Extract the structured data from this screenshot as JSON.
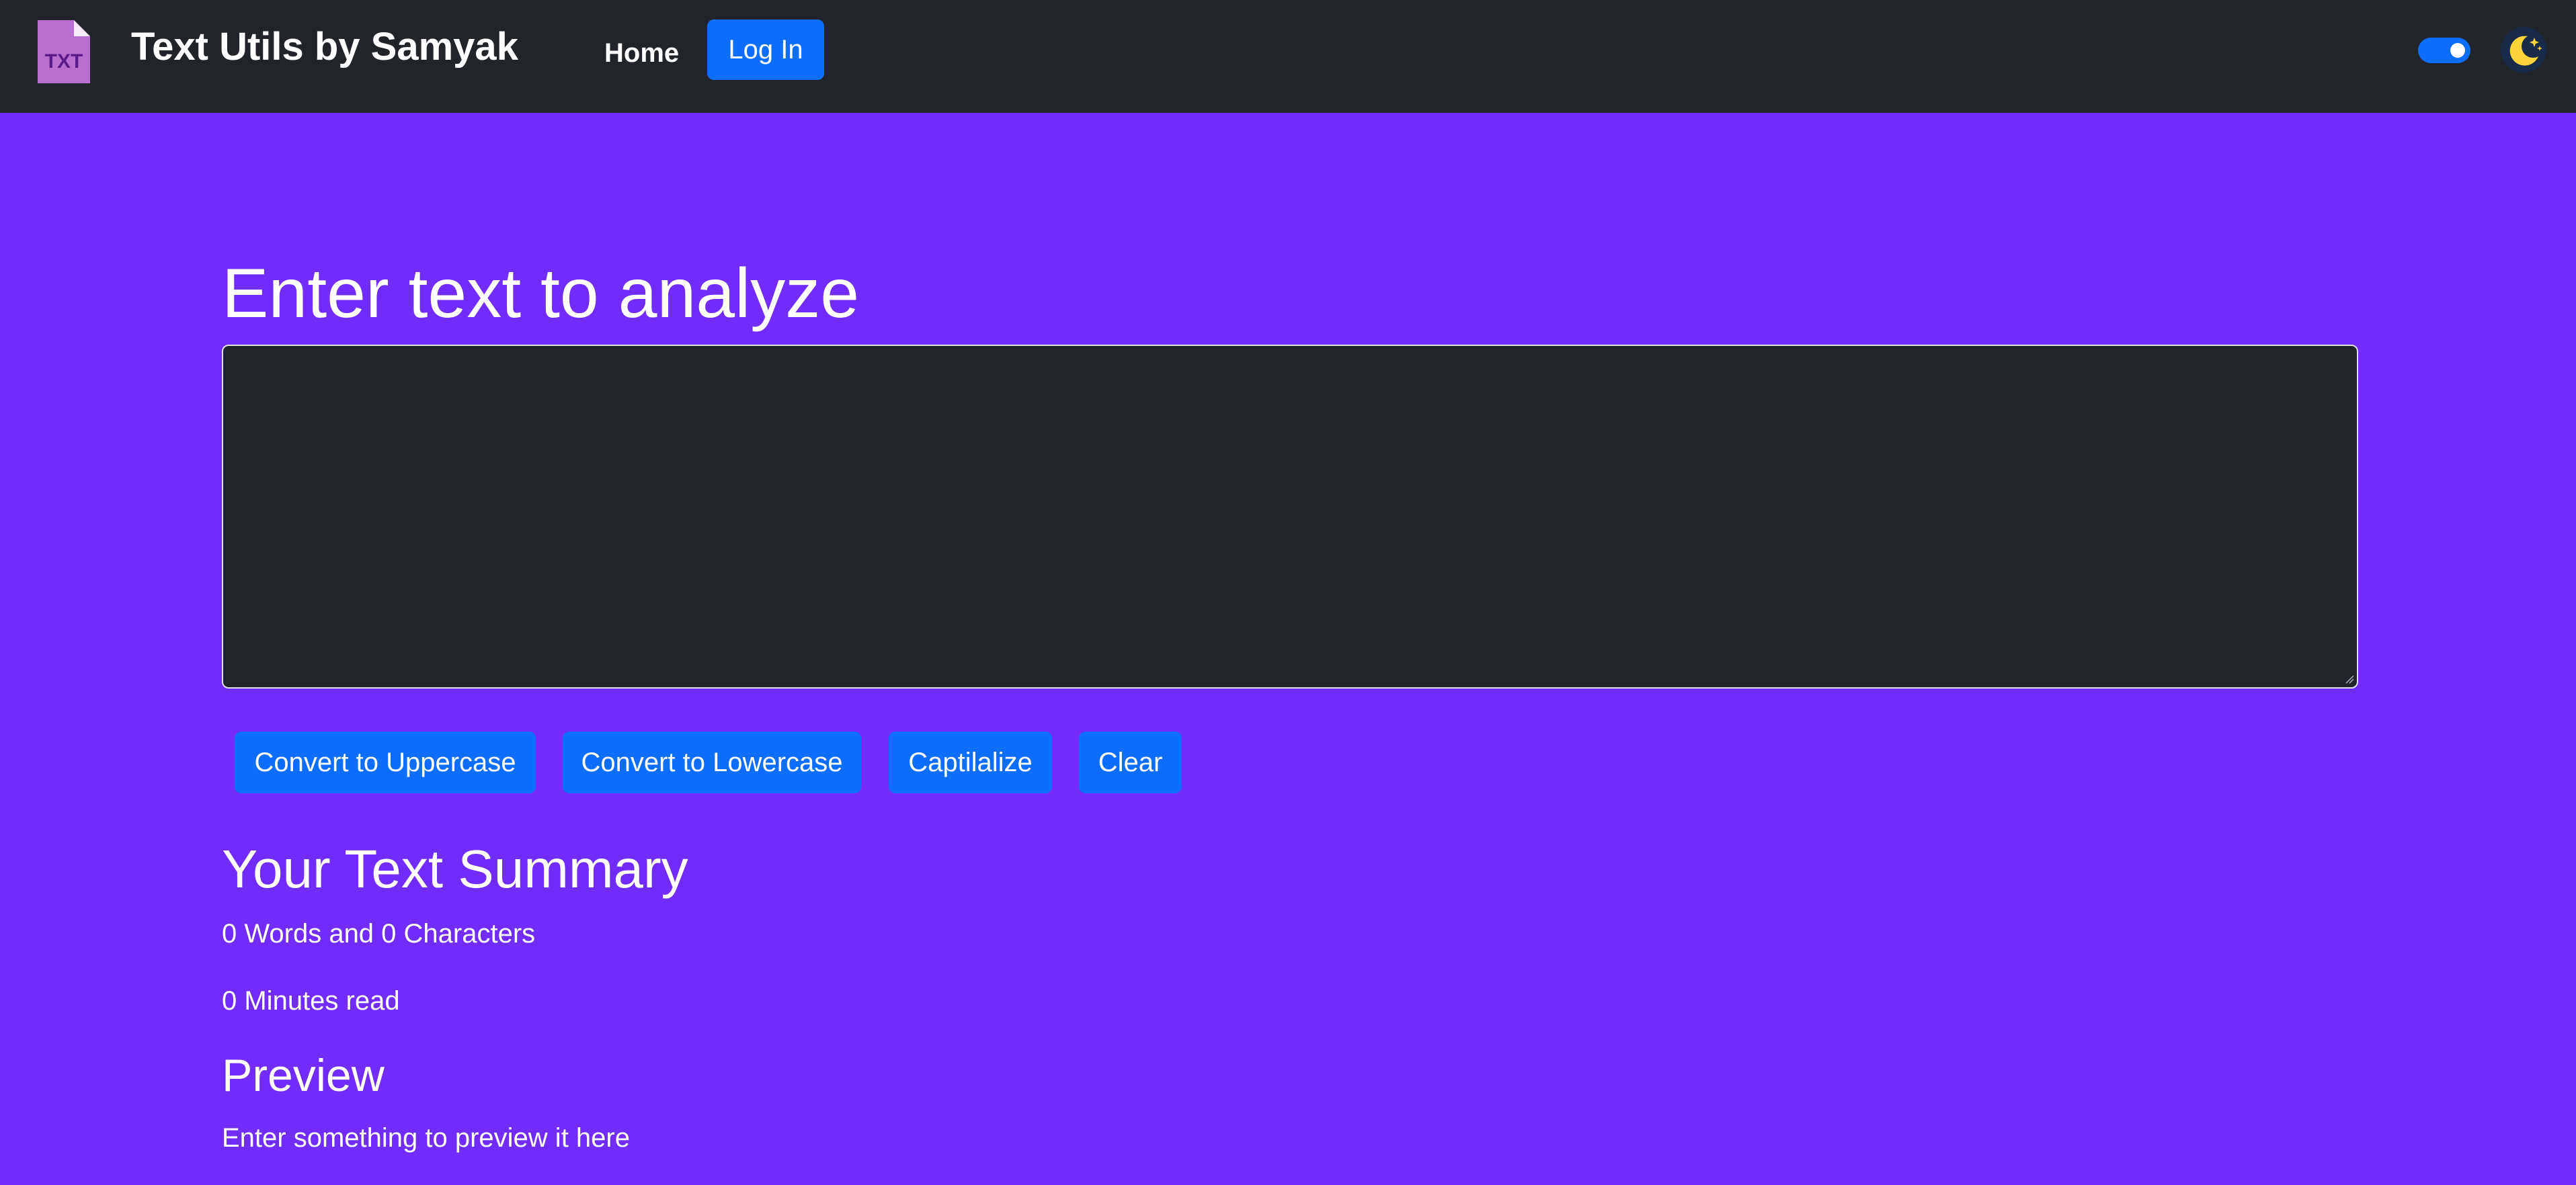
{
  "navbar": {
    "logo": {
      "icon": "txt-file-icon",
      "text": "TXT"
    },
    "brand": "Text Utils by Samyak",
    "home_label": "Home",
    "login_label": "Log In",
    "dark_mode_toggle": {
      "checked": true
    },
    "theme_icon": "moon-stars-icon"
  },
  "main": {
    "heading": "Enter text to analyze",
    "textarea": {
      "value": ""
    },
    "buttons": {
      "uppercase": "Convert to Uppercase",
      "lowercase": "Convert to Lowercase",
      "capitalize": "Captilalize",
      "clear": "Clear"
    },
    "summary": {
      "title": "Your Text Summary",
      "words_chars": "0 Words and 0 Characters",
      "read_time": "0 Minutes read"
    },
    "preview": {
      "title": "Preview",
      "text": "Enter something to preview it here"
    }
  },
  "colors": {
    "page_background": "#712cf9",
    "navbar_background": "#212529",
    "button_primary": "#0d6efd",
    "textarea_background": "#212529"
  }
}
